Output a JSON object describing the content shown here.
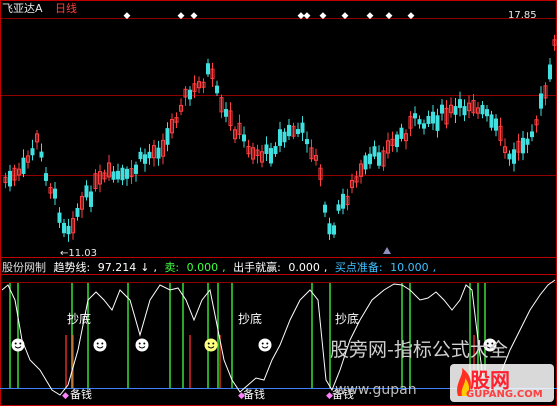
{
  "header": {
    "stock_name": "飞亚达A",
    "period": "日线",
    "price_max": "17.85",
    "price_min": "11.03"
  },
  "indicator": {
    "name": "股份网制",
    "trend_label": "趋势线:",
    "trend_value": "97.214",
    "trend_arrow": "↓",
    "sell_label": "卖:",
    "sell_value": "0.000",
    "exit_label": "出手就赢:",
    "exit_value": "0.000",
    "buy_ready_label": "买点准备:",
    "buy_ready_value": "10.000"
  },
  "labels": {
    "chaodi": "抄底",
    "beiqian": "备钱"
  },
  "watermark": {
    "title": "股旁网-指标公式大全",
    "url": "www.gupan",
    "logo": "股网",
    "logo_url": "GUPANG.COM"
  },
  "colors": {
    "background": "#000000",
    "up": "#ff4040",
    "down": "#40e0e0",
    "grid": "#c00000",
    "trend_line": "#ffffff",
    "signal_green": "#40ff40",
    "signal_red": "#ff3030",
    "buy_ready": "#00ffff",
    "sell": "#ffff00"
  },
  "icons": [
    "diamond-marker-icon",
    "smiley-face-icon",
    "triangle-marker-icon"
  ]
}
